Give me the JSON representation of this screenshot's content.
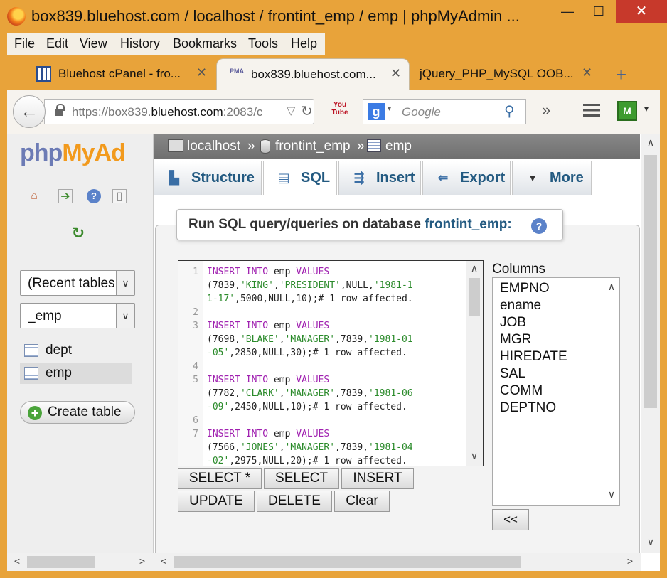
{
  "window": {
    "title": "box839.bluehost.com / localhost / frontint_emp / emp | phpMyAdmin ...",
    "minimize": "—",
    "maximize": "☐",
    "close": "✕"
  },
  "menu": [
    "File",
    "Edit",
    "View",
    "History",
    "Bookmarks",
    "Tools",
    "Help"
  ],
  "tabs": [
    {
      "label": "Bluehost cPanel - fro...",
      "close": "✕"
    },
    {
      "label": "box839.bluehost.com...",
      "close": "✕"
    },
    {
      "label": "jQuery_PHP_MySQL OOB...",
      "close": "✕"
    }
  ],
  "new_tab": "+",
  "nav": {
    "back": "←",
    "url_prefix": "https://box839.",
    "url_host": "bluehost.com",
    "url_rest": ":2083/c",
    "url_dropdown": "▽",
    "reload": "↻",
    "youtube_icon": "You Tube",
    "search_engine": "g",
    "search_dropdown": "▾",
    "search_placeholder": "Google",
    "overflow": "»",
    "shield": "M",
    "shield_dropdown": "▾"
  },
  "sidebar": {
    "logo_php": "php",
    "logo_myadmin": "MyAd",
    "recent_select": "(Recent tables)",
    "db_select": "_emp",
    "tables": [
      "dept",
      "emp"
    ],
    "create_table": "Create table",
    "create_icon": "+"
  },
  "breadcrumb": {
    "server": "localhost",
    "sep1": "»",
    "database": "frontint_emp",
    "sep2": "»",
    "table": "emp"
  },
  "main_tabs": [
    {
      "label": "Structure",
      "icon": "structure-icon"
    },
    {
      "label": "SQL",
      "icon": "sql-icon"
    },
    {
      "label": "Insert",
      "icon": "insert-icon"
    },
    {
      "label": "Export",
      "icon": "export-icon"
    },
    {
      "label": "More",
      "icon": "chevron-down-icon"
    }
  ],
  "sql_panel": {
    "legend_prefix": "Run SQL query/queries on database",
    "legend_db": "frontint_emp:",
    "help": "?"
  },
  "editor": {
    "lines": [
      {
        "n": "1",
        "parts": [
          [
            "kw",
            "INSERT "
          ],
          [
            "kw",
            "INTO "
          ],
          [
            "ident",
            "emp "
          ],
          [
            "kw",
            "VALUES"
          ]
        ]
      },
      {
        "n": "",
        "parts": [
          [
            "num",
            "(7839,"
          ],
          [
            "str",
            "'KING'"
          ],
          [
            "num",
            ","
          ],
          [
            "str",
            "'PRESIDENT'"
          ],
          [
            "num",
            ",NULL,"
          ],
          [
            "str",
            "'1981-1"
          ]
        ]
      },
      {
        "n": "",
        "parts": [
          [
            "str",
            "1-17'"
          ],
          [
            "num",
            ",5000,NULL,10);"
          ],
          [
            "cm",
            "# 1 row affected."
          ]
        ]
      },
      {
        "n": "2",
        "parts": []
      },
      {
        "n": "3",
        "parts": [
          [
            "kw",
            "INSERT "
          ],
          [
            "kw",
            "INTO "
          ],
          [
            "ident",
            "emp "
          ],
          [
            "kw",
            "VALUES"
          ]
        ]
      },
      {
        "n": "",
        "parts": [
          [
            "num",
            "(7698,"
          ],
          [
            "str",
            "'BLAKE'"
          ],
          [
            "num",
            ","
          ],
          [
            "str",
            "'MANAGER'"
          ],
          [
            "num",
            ",7839,"
          ],
          [
            "str",
            "'1981-01"
          ]
        ]
      },
      {
        "n": "",
        "parts": [
          [
            "str",
            "-05'"
          ],
          [
            "num",
            ",2850,NULL,30);"
          ],
          [
            "cm",
            "# 1 row affected."
          ]
        ]
      },
      {
        "n": "4",
        "parts": []
      },
      {
        "n": "5",
        "parts": [
          [
            "kw",
            "INSERT "
          ],
          [
            "kw",
            "INTO "
          ],
          [
            "ident",
            "emp "
          ],
          [
            "kw",
            "VALUES"
          ]
        ]
      },
      {
        "n": "",
        "parts": [
          [
            "num",
            "(7782,"
          ],
          [
            "str",
            "'CLARK'"
          ],
          [
            "num",
            ","
          ],
          [
            "str",
            "'MANAGER'"
          ],
          [
            "num",
            ",7839,"
          ],
          [
            "str",
            "'1981-06"
          ]
        ]
      },
      {
        "n": "",
        "parts": [
          [
            "str",
            "-09'"
          ],
          [
            "num",
            ",2450,NULL,10);"
          ],
          [
            "cm",
            "# 1 row affected."
          ]
        ]
      },
      {
        "n": "6",
        "parts": []
      },
      {
        "n": "7",
        "parts": [
          [
            "kw",
            "INSERT "
          ],
          [
            "kw",
            "INTO "
          ],
          [
            "ident",
            "emp "
          ],
          [
            "kw",
            "VALUES"
          ]
        ]
      },
      {
        "n": "",
        "parts": [
          [
            "num",
            "(7566,"
          ],
          [
            "str",
            "'JONES'"
          ],
          [
            "num",
            ","
          ],
          [
            "str",
            "'MANAGER'"
          ],
          [
            "num",
            ",7839,"
          ],
          [
            "str",
            "'1981-04"
          ]
        ]
      },
      {
        "n": "",
        "parts": [
          [
            "str",
            "-02'"
          ],
          [
            "num",
            ",2975,NULL,20);"
          ],
          [
            "cm",
            "# 1 row affected."
          ]
        ]
      }
    ],
    "scroll_up": "∧",
    "scroll_down": "∨"
  },
  "sql_buttons": {
    "select_all": "SELECT *",
    "select": "SELECT",
    "insert": "INSERT",
    "update": "UPDATE",
    "delete": "DELETE",
    "clear": "Clear"
  },
  "columns": {
    "label": "Columns",
    "items": [
      "EMPNO",
      "ename",
      "JOB",
      "MGR",
      "HIREDATE",
      "SAL",
      "COMM",
      "DEPTNO"
    ],
    "insert_button": "<<",
    "scroll_up": "∧",
    "scroll_down": "∨"
  },
  "scrollbars": {
    "up": "∧",
    "down": "∨",
    "left": "<",
    "right": ">"
  }
}
